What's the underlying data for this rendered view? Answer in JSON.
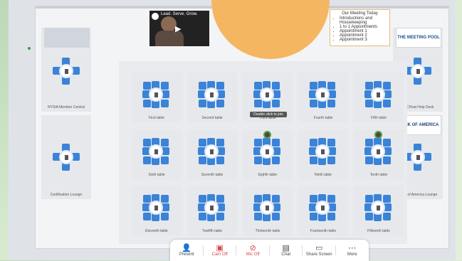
{
  "video": {
    "title": "Lead. Serve. Grow."
  },
  "agenda": {
    "title": "Our Meeting Today",
    "items": [
      "Introductions and Housekeeping",
      "1 to 1 Appointments",
      "Appointment 1",
      "Appointment 2",
      "Appointment 3"
    ]
  },
  "booths": {
    "left_top": {
      "caption": "NYSIA Member Central"
    },
    "left_bottom": {
      "caption": "Certification Lounge"
    },
    "right_top": {
      "sign": "THE MEETING POOL",
      "caption": "TECHsat Help Desk"
    },
    "right_bottom": {
      "sign": "BANK OF AMERICA",
      "caption": "Bank of America Lounge"
    }
  },
  "tables": [
    {
      "caption": "First table"
    },
    {
      "caption": "Second table"
    },
    {
      "caption": "Third table"
    },
    {
      "caption": "Fourth table"
    },
    {
      "caption": "Fifth table"
    },
    {
      "caption": "Sixth table"
    },
    {
      "caption": "Seventh table"
    },
    {
      "caption": "Eighth table"
    },
    {
      "caption": "Ninth table"
    },
    {
      "caption": "Tenth table"
    },
    {
      "caption": "Eleventh table"
    },
    {
      "caption": "Twelfth table"
    },
    {
      "caption": "Thirteenth table"
    },
    {
      "caption": "Fourteenth table"
    },
    {
      "caption": "Fifteenth table"
    }
  ],
  "tooltip": {
    "text": "Double click to join"
  },
  "toolbar": {
    "present": "Present",
    "cam": "Cam Off",
    "mic": "Mic Off",
    "chat": "Chat",
    "share": "Share Screen",
    "more": "More"
  },
  "colors": {
    "seat": "#3a83d8",
    "off": "#d44a4a",
    "stage": "#f4b661"
  }
}
